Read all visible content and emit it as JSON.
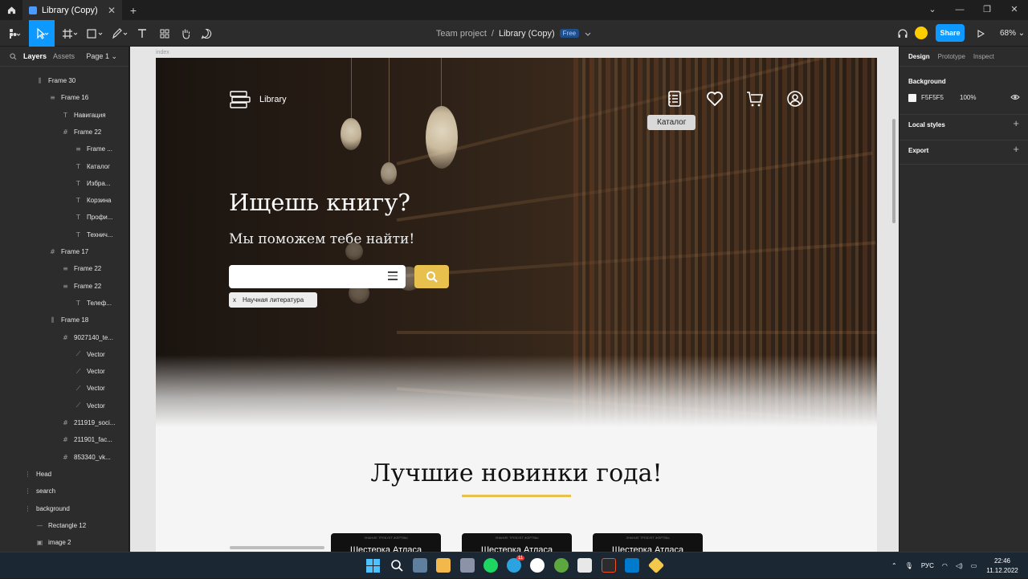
{
  "window": {
    "tab_title": "Library (Copy)",
    "new_tab": "+",
    "controls": [
      "⌄",
      "—",
      "❐",
      "✕"
    ]
  },
  "toolbar": {
    "project": "Team project",
    "separator": "/",
    "file_name": "Library (Copy)",
    "plan_badge": "Free",
    "share_label": "Share",
    "zoom": "68%"
  },
  "left_panel": {
    "tabs": [
      "Layers",
      "Assets"
    ],
    "page": "Page 1",
    "layers": [
      {
        "icon": "frame-icon",
        "label": "Frame 30",
        "indent": 0
      },
      {
        "icon": "rows-icon",
        "label": "Frame 16",
        "indent": 1
      },
      {
        "icon": "text-icon",
        "label": "Навигация",
        "indent": 2
      },
      {
        "icon": "grid-icon",
        "label": "Frame 22",
        "indent": 2
      },
      {
        "icon": "rows-icon",
        "label": "Frame ...",
        "indent": 3
      },
      {
        "icon": "text-icon",
        "label": "Каталог",
        "indent": 3
      },
      {
        "icon": "text-icon",
        "label": "Избра...",
        "indent": 3
      },
      {
        "icon": "text-icon",
        "label": "Корзина",
        "indent": 3
      },
      {
        "icon": "text-icon",
        "label": "Профи...",
        "indent": 3
      },
      {
        "icon": "text-icon",
        "label": "Технич...",
        "indent": 3
      },
      {
        "icon": "grid-icon",
        "label": "Frame 17",
        "indent": 1
      },
      {
        "icon": "rows-icon",
        "label": "Frame 22",
        "indent": 2
      },
      {
        "icon": "rows-icon",
        "label": "Frame 22",
        "indent": 2
      },
      {
        "icon": "text-icon",
        "label": "Телеф...",
        "indent": 3
      },
      {
        "icon": "frame-icon",
        "label": "Frame 18",
        "indent": 1
      },
      {
        "icon": "grid-icon",
        "label": "9027140_te...",
        "indent": 2
      },
      {
        "icon": "vector-icon",
        "label": "Vector",
        "indent": 3
      },
      {
        "icon": "vector-icon",
        "label": "Vector",
        "indent": 3
      },
      {
        "icon": "vector-icon",
        "label": "Vector",
        "indent": 3
      },
      {
        "icon": "vector-icon",
        "label": "Vector",
        "indent": 3
      },
      {
        "icon": "grid-icon",
        "label": "211919_soci...",
        "indent": 2
      },
      {
        "icon": "grid-icon",
        "label": "211901_fac...",
        "indent": 2
      },
      {
        "icon": "grid-icon",
        "label": "853340_vk...",
        "indent": 2
      },
      {
        "icon": "dotted-frame-icon",
        "label": "Head",
        "indent": -1
      },
      {
        "icon": "dotted-frame-icon",
        "label": "search",
        "indent": -1
      },
      {
        "icon": "dotted-frame-icon",
        "label": "background",
        "indent": -1
      },
      {
        "icon": "rect-icon",
        "label": "Rectangle 12",
        "indent": 0
      },
      {
        "icon": "image-icon",
        "label": "image 2",
        "indent": 0
      }
    ]
  },
  "canvas": {
    "frame_label": "index",
    "site": {
      "logo_text": "Library",
      "tooltip": "Каталог",
      "headline": "Ищешь книгу?",
      "subheadline": "Мы поможем тебе найти!",
      "search_placeholder": "",
      "chip_close": "x",
      "chip_label": "Научная литература",
      "section_title": "Лучшие новинки года!",
      "cards": [
        {
          "title": "Шестерка Атласа",
          "tagline": "ЗНАНИЕ ТРЕБУЕТ ЖЕРТВЫ"
        },
        {
          "title": "Шестерка Атласа",
          "tagline": "ЗНАНИЕ ТРЕБУЕТ ЖЕРТВЫ"
        },
        {
          "title": "Шестерка Атласа",
          "tagline": "ЗНАНИЕ ТРЕБУЕТ ЖЕРТВЫ"
        }
      ],
      "accent_color": "#e7c04e"
    },
    "help": "?"
  },
  "right_panel": {
    "tabs": [
      "Design",
      "Prototype",
      "Inspect"
    ],
    "background_title": "Background",
    "bg_hex": "F5F5F5",
    "bg_opacity": "100%",
    "local_styles": "Local styles",
    "export": "Export",
    "plus": "+"
  },
  "taskbar": {
    "language": "РУС",
    "time": "22:46",
    "date": "11.12.2022",
    "telegram_badge": "11"
  }
}
